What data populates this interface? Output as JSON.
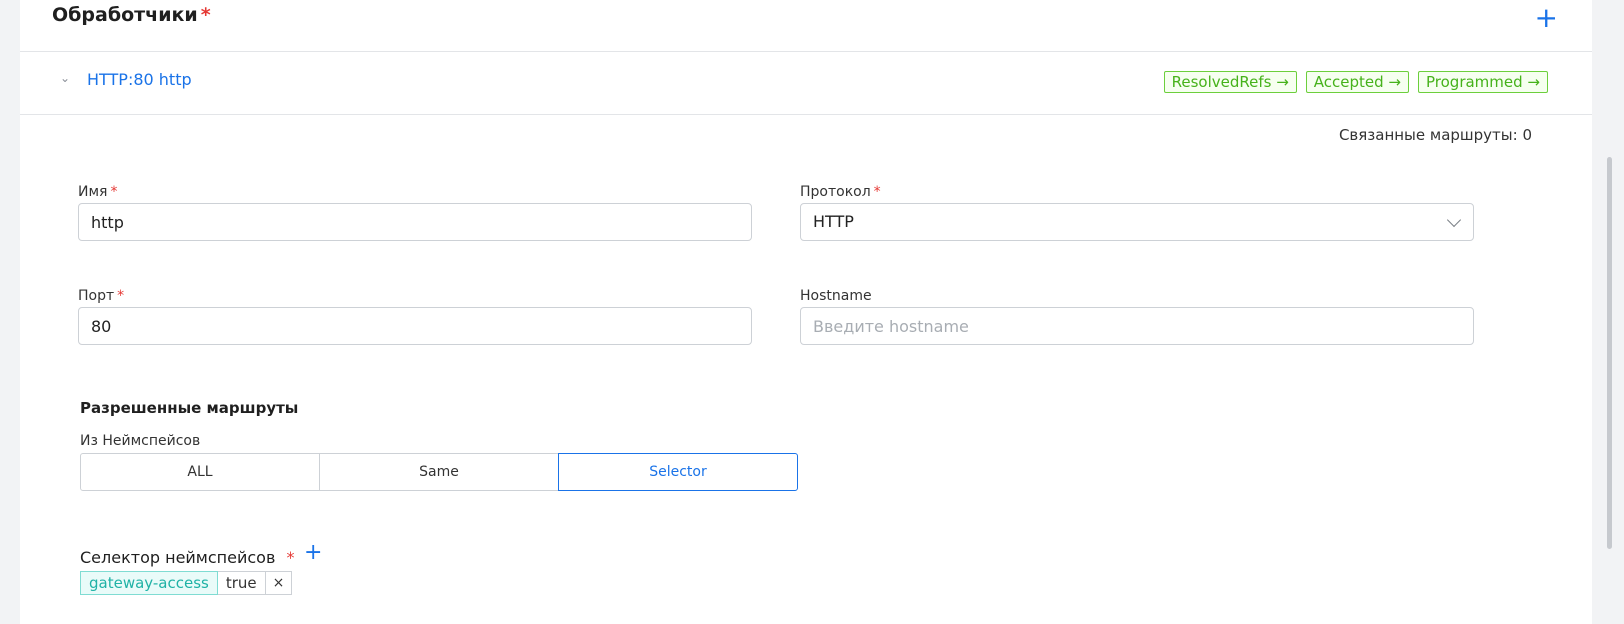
{
  "section": {
    "title": "Обработчики",
    "required_mark": "*"
  },
  "listener": {
    "name": "HTTP:80 http",
    "tags": [
      "ResolvedRefs →",
      "Accepted →",
      "Programmed →"
    ],
    "routes_count_text": "Связанные маршруты: 0"
  },
  "form": {
    "name": {
      "label": "Имя",
      "required_mark": "*",
      "value": "http"
    },
    "protocol": {
      "label": "Протокол",
      "required_mark": "*",
      "value": "HTTP"
    },
    "port": {
      "label": "Порт",
      "required_mark": "*",
      "value": "80"
    },
    "hostname": {
      "label": "Hostname",
      "value": "",
      "placeholder": "Введите hostname"
    }
  },
  "allowed_routes": {
    "title": "Разрешенные маршруты",
    "from_label": "Из Неймспейсов",
    "options": [
      "ALL",
      "Same",
      "Selector"
    ],
    "selected": "Selector"
  },
  "selector": {
    "label": "Селектор неймспейсов",
    "required_mark": "*",
    "key": "gateway-access",
    "value": "true",
    "remove": "×"
  },
  "colors": {
    "accent": "#1a73e8",
    "success": "#46b21b",
    "teal": "#20b2a6",
    "required": "#e53935"
  }
}
